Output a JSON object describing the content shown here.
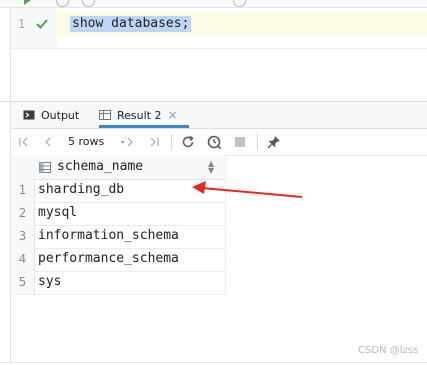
{
  "editor": {
    "line_number": "1",
    "code": "show databases;"
  },
  "panel": {
    "tabs": [
      {
        "label": "Output"
      },
      {
        "label": "Result 2"
      }
    ]
  },
  "navbar": {
    "rows_label": "5 rows"
  },
  "grid": {
    "column": "schema_name",
    "rows": [
      {
        "num": "1",
        "value": "sharding_db"
      },
      {
        "num": "2",
        "value": "mysql"
      },
      {
        "num": "3",
        "value": "information_schema"
      },
      {
        "num": "4",
        "value": "performance_schema"
      },
      {
        "num": "5",
        "value": "sys"
      }
    ]
  },
  "colors": {
    "selection": "#bcd6f5",
    "accent_tab": "#4083c9",
    "annotation_arrow": "#e8281e",
    "check": "#5aa052"
  },
  "watermark": "CSDN @lzss"
}
